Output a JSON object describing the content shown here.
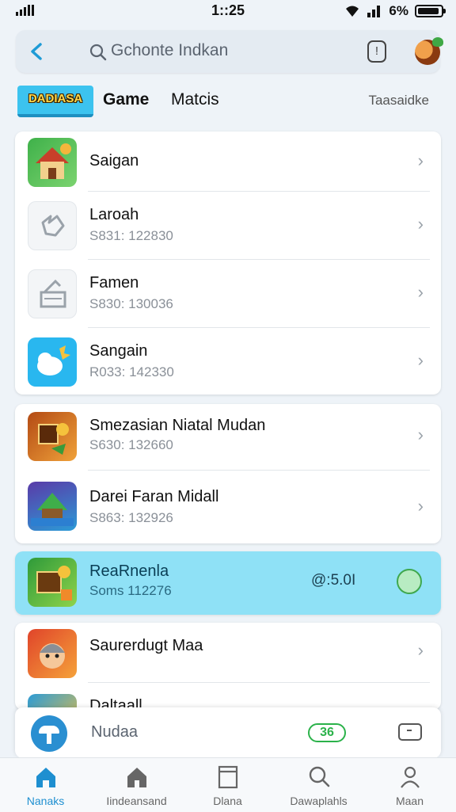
{
  "status_bar": {
    "time": "1::25",
    "battery_text": "6%"
  },
  "header": {
    "search_text": "Gchonte Indkan"
  },
  "tabs": {
    "featured": "DADIASA",
    "game": "Game",
    "matches": "Matcis",
    "right": "Taasaidke"
  },
  "list_group_1": [
    {
      "title": "Saigan",
      "subtitle": ""
    },
    {
      "title": "Laroah",
      "subtitle": "S831: 122830"
    },
    {
      "title": "Famen",
      "subtitle": "S830: 130036"
    },
    {
      "title": "Sangain",
      "subtitle": "R033: 142330"
    }
  ],
  "list_group_2": [
    {
      "title": "Smezasian Niatal Mudan",
      "subtitle": "S630: 132660"
    },
    {
      "title": "Darei Faran Midall",
      "subtitle": "S863: 132926"
    }
  ],
  "highlighted_row": {
    "title": "ReaRnenla",
    "subtitle": "Soms 112276",
    "score": "@:5.0I"
  },
  "list_group_3": [
    {
      "title": "Saurerdugt Maa"
    },
    {
      "title": "Daltaall"
    }
  ],
  "mini_player": {
    "label": "Nudaa",
    "badge": "36"
  },
  "bottom_nav": [
    {
      "label": "Nanaks",
      "icon": "home-icon"
    },
    {
      "label": "Iindeansand",
      "icon": "house-outline-icon"
    },
    {
      "label": "Dlana",
      "icon": "window-icon"
    },
    {
      "label": "Dawaplahls",
      "icon": "search-icon"
    },
    {
      "label": "Maan",
      "icon": "user-icon"
    }
  ],
  "colors": {
    "accent": "#1e9bd6",
    "highlight_row": "#8fe1f6",
    "badge_green": "#2bb24a",
    "background": "#eef3f8"
  }
}
